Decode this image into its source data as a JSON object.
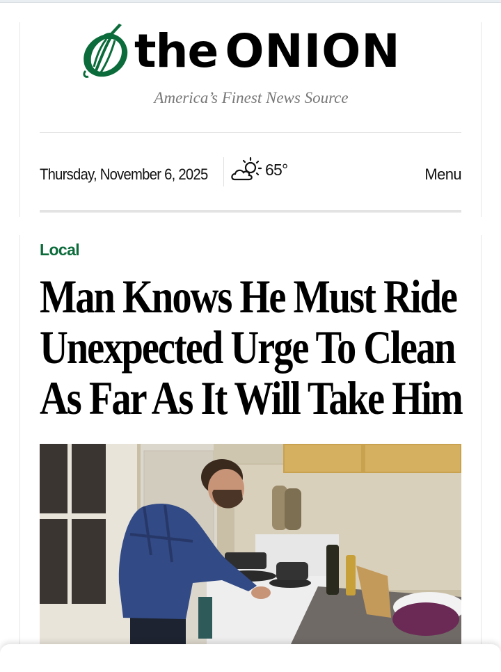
{
  "site": {
    "logo_text_the": "the",
    "logo_text_onion": "ONION",
    "tagline": "America’s Finest News Source",
    "date": "Thursday, November 6, 2025",
    "weather": {
      "icon": "partly-cloudy-icon",
      "temperature": "65°"
    },
    "menu_label": "Menu",
    "brand_color": "#0b6b3a"
  },
  "article": {
    "category": "Local",
    "headline_lines": [
      "Man Knows He Must Ride",
      "Unexpected Urge To Clean",
      "As Far As It Will Take Him"
    ],
    "image": {
      "subject": "man-cleaning-stove-photo"
    }
  }
}
